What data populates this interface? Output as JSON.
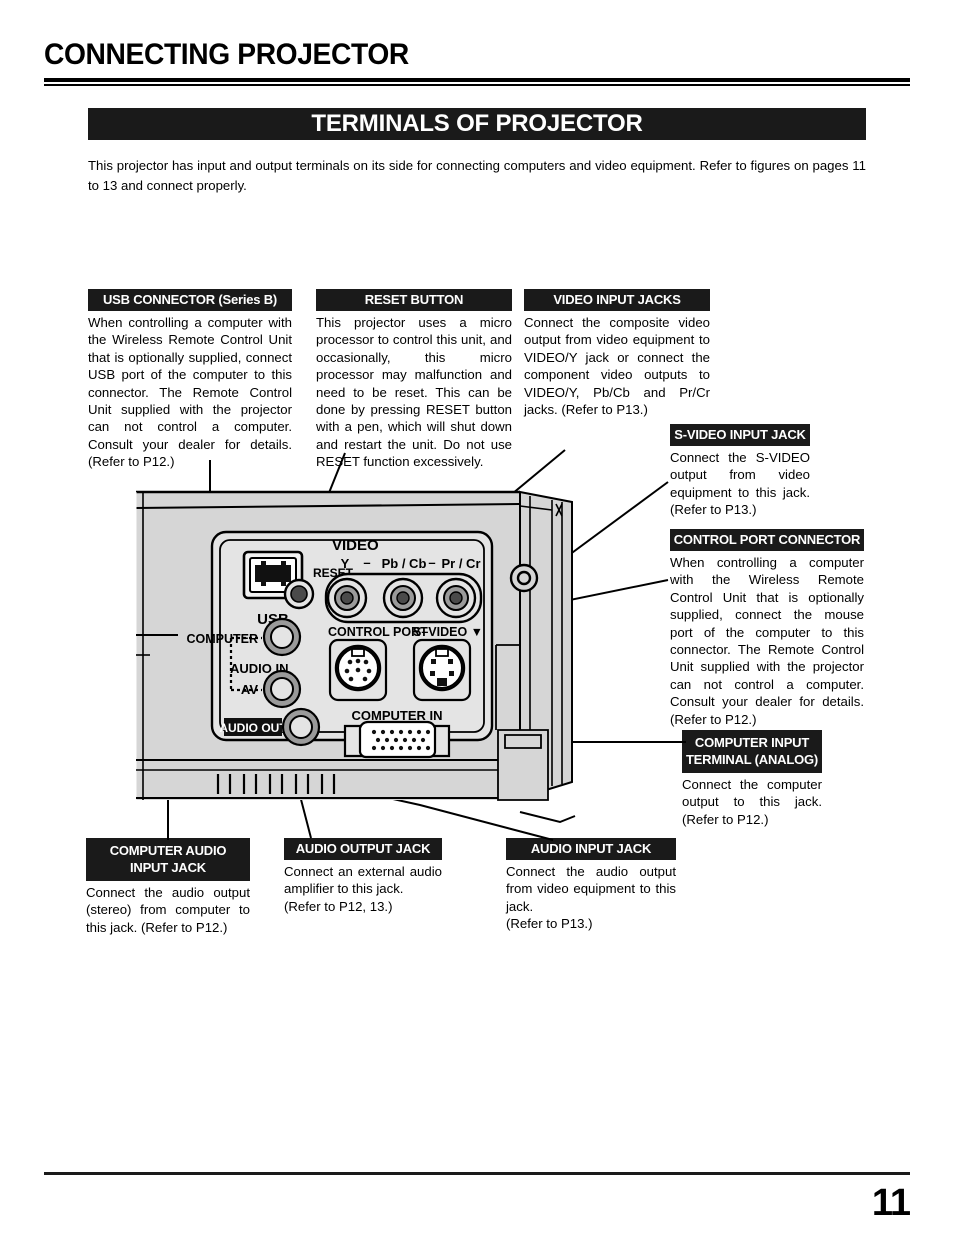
{
  "header": {
    "chapter_title": "CONNECTING PROJECTOR",
    "section_title": "TERMINALS OF PROJECTOR",
    "intro_text": "This projector has input and output terminals on its side for connecting computers and video equipment.  Refer to figures on pages 11 to 13 and connect properly."
  },
  "callouts": {
    "usb": {
      "title": "USB CONNECTOR (Series B)",
      "body": "When controlling a computer with the Wireless Remote Control Unit that is optionally supplied, connect USB port of the computer to this connector. The Remote Control Unit supplied with the projector can not control a computer. Consult your dealer for details. (Refer to P12.)"
    },
    "reset": {
      "title": "RESET BUTTON",
      "body": "This projector uses a micro processor to control this unit, and occasionally, this micro processor may malfunction and need to be reset.  This can be done by pressing RESET button with a pen, which will shut down and restart the unit.  Do not use RESET function excessively."
    },
    "video_input": {
      "title": "VIDEO INPUT JACKS",
      "body": "Connect the composite video output from video equipment to VIDEO/Y jack or connect the component video outputs to VIDEO/Y, Pb/Cb and Pr/Cr jacks.  (Refer to P13.)"
    },
    "svideo": {
      "title": "S-VIDEO INPUT JACK",
      "body": "Connect the S-VIDEO output from video equipment to this jack.  (Refer to P13.)"
    },
    "control_port": {
      "title": "CONTROL PORT CONNECTOR",
      "body": "When controlling a computer with the Wireless Remote Control Unit that is optionally supplied, connect the mouse port of the computer to this connector.   The Remote Control Unit supplied with the projector can not control a computer. Consult your dealer for details.(Refer to P12.)"
    },
    "computer_input": {
      "title_line1": "COMPUTER INPUT",
      "title_line2": "TERMINAL (ANALOG)",
      "body": "Connect the computer output to this jack. (Refer to P12.)"
    },
    "computer_audio_input": {
      "title_line1": "COMPUTER AUDIO",
      "title_line2": "INPUT JACK",
      "body": "Connect the audio output (stereo) from computer to this jack.  (Refer to P12.)"
    },
    "audio_output": {
      "title": "AUDIO OUTPUT JACK",
      "body": "Connect an external audio amplifier to this jack.",
      "body2": "(Refer to P12, 13.)"
    },
    "audio_input": {
      "title": "AUDIO INPUT JACK",
      "body": "Connect the audio output from video equipment to this jack.",
      "body2": "(Refer to P13.)"
    }
  },
  "diagram_labels": {
    "usb": "USB",
    "reset": "RESET",
    "video": "VIDEO",
    "video_y": "Y",
    "video_dash1": "–",
    "video_pbcb": "Pb / Cb",
    "video_dash2": "–",
    "video_prcr": "Pr / Cr",
    "control_port": "CONTROL PORT",
    "svideo": "S–VIDEO ▼",
    "computer_in": "COMPUTER IN",
    "audio_in": "AUDIO IN",
    "computer": "COMPUTER",
    "av": "AV",
    "audio_out": "AUDIO OUT"
  },
  "footer": {
    "page_number": "11"
  },
  "colors": {
    "ink": "#000000",
    "bar_bg": "#1a1a1a",
    "bar_text": "#ffffff",
    "body_fill": "#d6d6d6",
    "panel_fill": "#e4e4e4",
    "jack_ring": "#9a9a9a",
    "jack_center": "#5a5a5a"
  }
}
